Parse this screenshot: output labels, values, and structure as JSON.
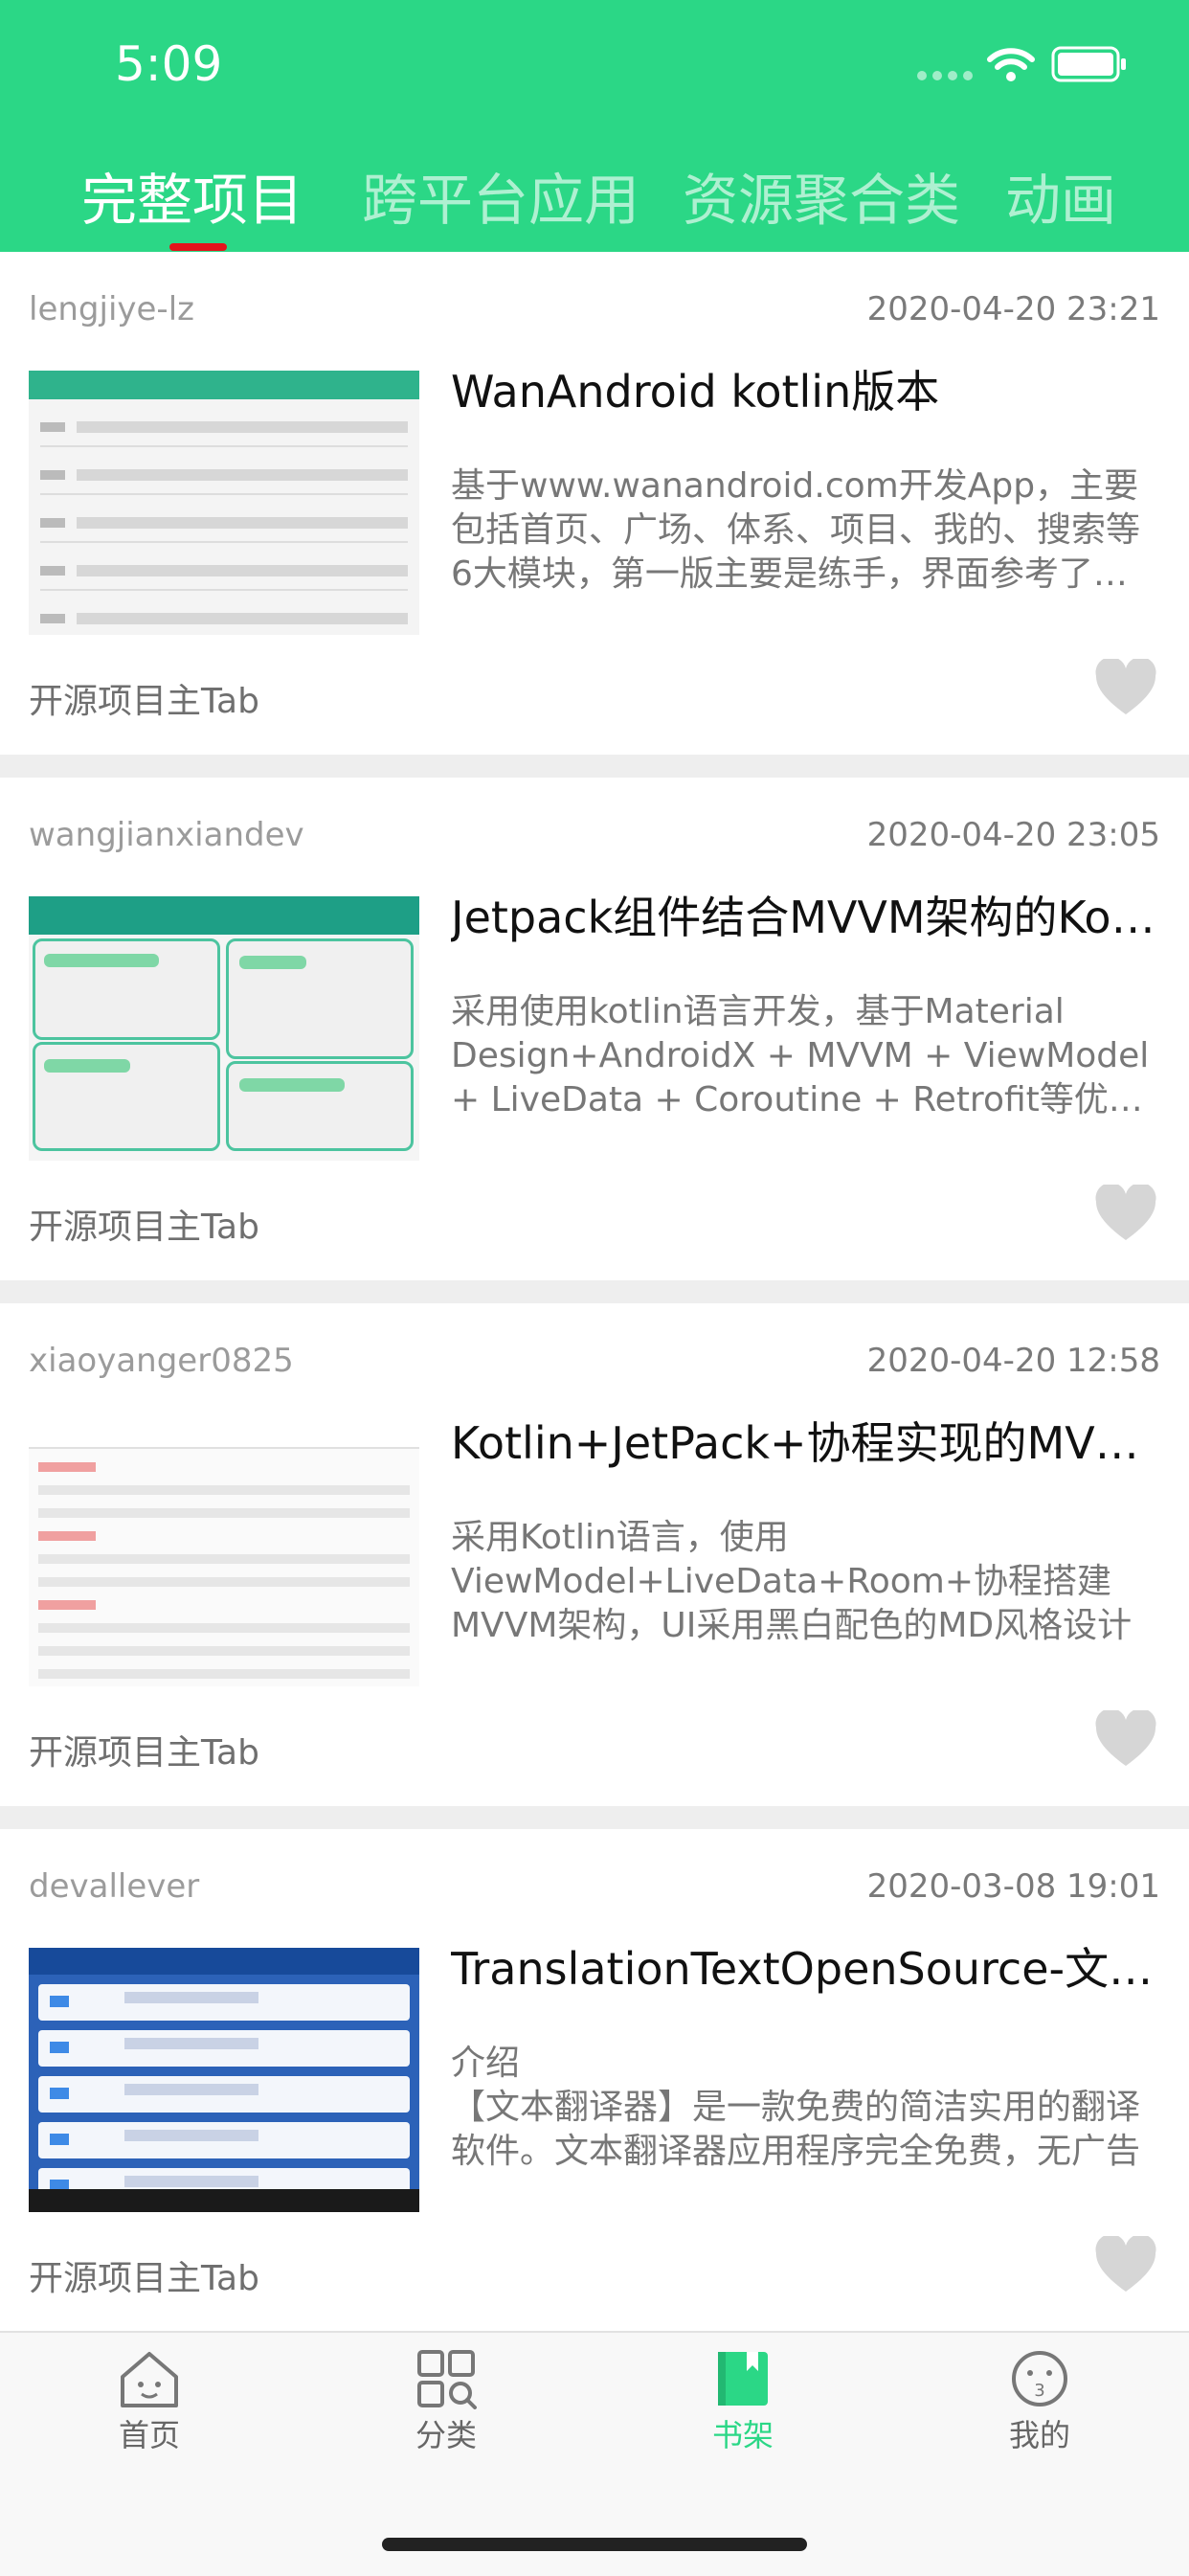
{
  "status_bar": {
    "time": "5:09"
  },
  "tabs": [
    {
      "label": "完整项目",
      "active": true
    },
    {
      "label": "跨平台应用",
      "active": false
    },
    {
      "label": "资源聚合类",
      "active": false
    },
    {
      "label": "动画",
      "active": false
    }
  ],
  "items": [
    {
      "author": "lengjiye-lz",
      "date": "2020-04-20 23:21",
      "title": "WanAndroid kotlin版本",
      "desc": "基于www.wanandroid.com开发App，主要包括首页、广场、体系、项目、我的、搜索等6大模块，第一版主要是练手，界面参考了一些开源项目",
      "tag": "开源项目主Tab",
      "liked": false
    },
    {
      "author": "wangjianxiandev",
      "date": "2020-04-20 23:05",
      "title": "Jetpack组件结合MVVM架构的Kotlin版WanAndroid",
      "desc": "采用使用kotlin语言开发，基于Material Design+AndroidX + MVVM + ViewModel + LiveData + Coroutine + Retrofit等优秀的开源框架",
      "tag": "开源项目主Tab",
      "liked": false
    },
    {
      "author": "xiaoyanger0825",
      "date": "2020-04-20 12:58",
      "title": "Kotlin+JetPack+协程实现的MVVM架构Wanandroid客户端",
      "desc": "采用Kotlin语言，使用ViewModel+LiveData+Room+协程搭建MVVM架构，UI采用黑白配色的MD风格设计",
      "tag": "开源项目主Tab",
      "liked": false
    },
    {
      "author": "devallever",
      "date": "2020-03-08 19:01",
      "title": "TranslationTextOpenSource-文本翻译器",
      "desc": "介绍\n【文本翻译器】是一款免费的简洁实用的翻译软件。文本翻译器应用程序完全免费，无广告",
      "tag": "开源项目主Tab",
      "liked": false
    }
  ],
  "bottom_nav": [
    {
      "label": "首页",
      "icon": "home-icon",
      "active": false
    },
    {
      "label": "分类",
      "icon": "category-grid-icon",
      "active": false
    },
    {
      "label": "书架",
      "icon": "bookshelf-icon",
      "active": true
    },
    {
      "label": "我的",
      "icon": "profile-face-icon",
      "active": false
    }
  ],
  "colors": {
    "primary": "#2bd786",
    "indicator": "#e4141b",
    "heart": "#d6d6d6"
  }
}
